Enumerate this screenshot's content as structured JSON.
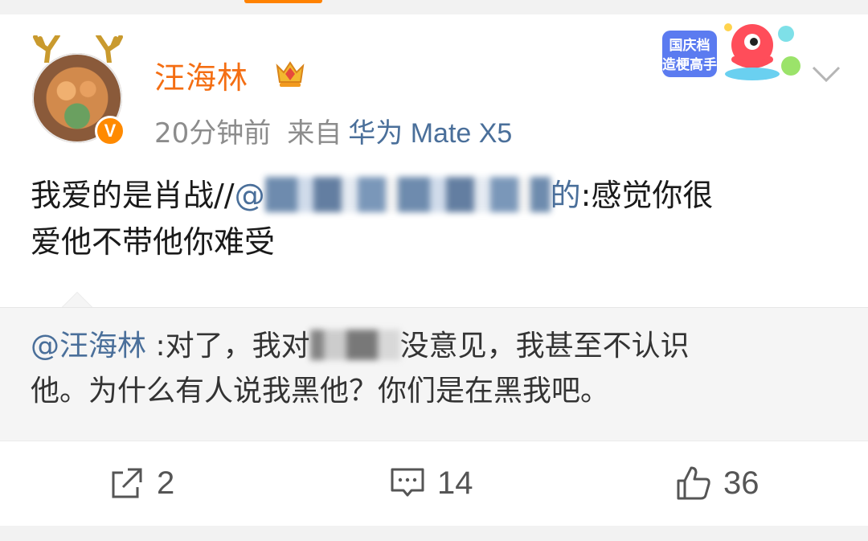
{
  "post": {
    "username": "汪海林",
    "verified_badge": "V",
    "time": "20分钟前",
    "from_label": "来自",
    "device": "华为 Mate X5",
    "text_prefix": "我爱的是肖战//",
    "mention_at": "@",
    "mention_visible_end": "的",
    "text_suffix_line1": ":感觉你很",
    "text_line2": "爱他不带他你难受"
  },
  "repost": {
    "mention": "@汪海林",
    "text_line1_before_blur": " :对了，我对",
    "text_line1_after_blur": "没意见，我甚至不认识",
    "text_line2": "他。为什么有人说我黑他？你们是在黑我吧。"
  },
  "sticker": {
    "line1": "国庆档",
    "line2": "造梗高手"
  },
  "actions": {
    "repost_count": "2",
    "comment_count": "14",
    "like_count": "36"
  },
  "colors": {
    "username": "#f46e13",
    "link": "#4a6f9a",
    "accent": "#ff8200"
  },
  "icons": [
    "chevron-down-icon",
    "repost-icon",
    "comment-icon",
    "like-icon",
    "crown-icon",
    "verified-badge-icon"
  ]
}
